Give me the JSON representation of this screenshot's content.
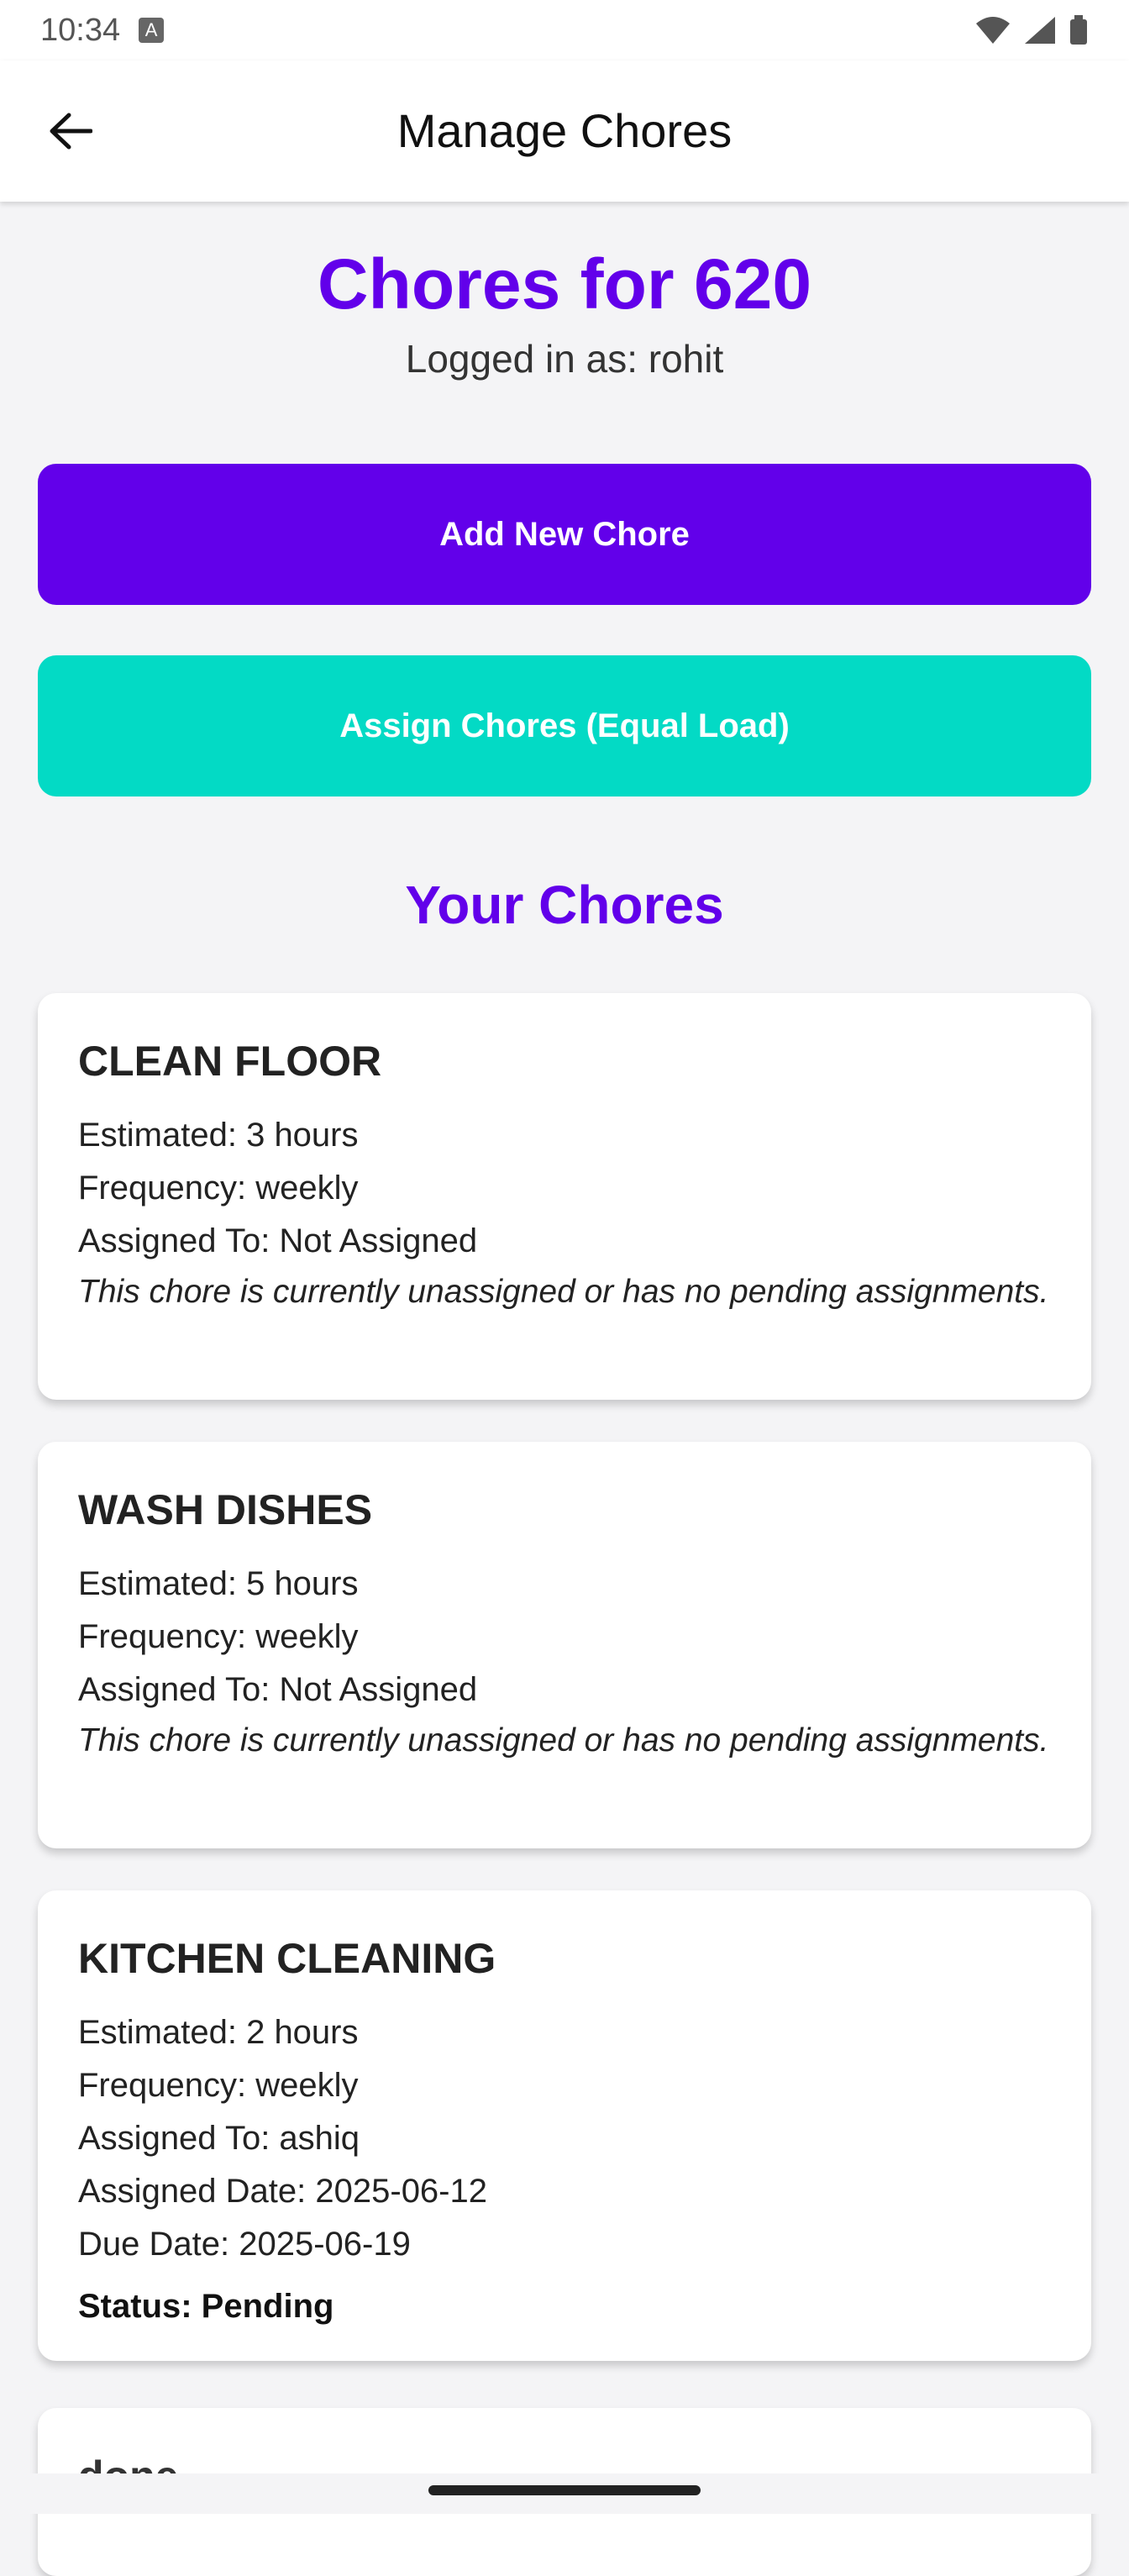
{
  "status_bar": {
    "time": "10:34"
  },
  "app_bar": {
    "title": "Manage Chores"
  },
  "header": {
    "title": "Chores for 620",
    "logged_in": "Logged in as: rohit"
  },
  "actions": {
    "add_label": "Add New Chore",
    "assign_label": "Assign Chores (Equal Load)"
  },
  "section_title": "Your Chores",
  "chores": [
    {
      "name": "CLEAN FLOOR",
      "estimated": "Estimated: 3 hours",
      "frequency": "Frequency: weekly",
      "assigned_to": "Assigned To: Not Assigned",
      "note": "This chore is currently unassigned or has no pending assignments."
    },
    {
      "name": "WASH DISHES",
      "estimated": "Estimated: 5 hours",
      "frequency": "Frequency: weekly",
      "assigned_to": "Assigned To: Not Assigned",
      "note": "This chore is currently unassigned or has no pending assignments."
    },
    {
      "name": "KITCHEN CLEANING",
      "estimated": "Estimated: 2 hours",
      "frequency": "Frequency: weekly",
      "assigned_to": "Assigned To: ashiq",
      "assigned_date": "Assigned Date: 2025-06-12",
      "due_date": "Due Date: 2025-06-19",
      "status": "Status: Pending"
    },
    {
      "name": "done"
    }
  ],
  "colors": {
    "primary": "#6200ea",
    "secondary": "#03dac5",
    "background": "#f4f4f6"
  }
}
